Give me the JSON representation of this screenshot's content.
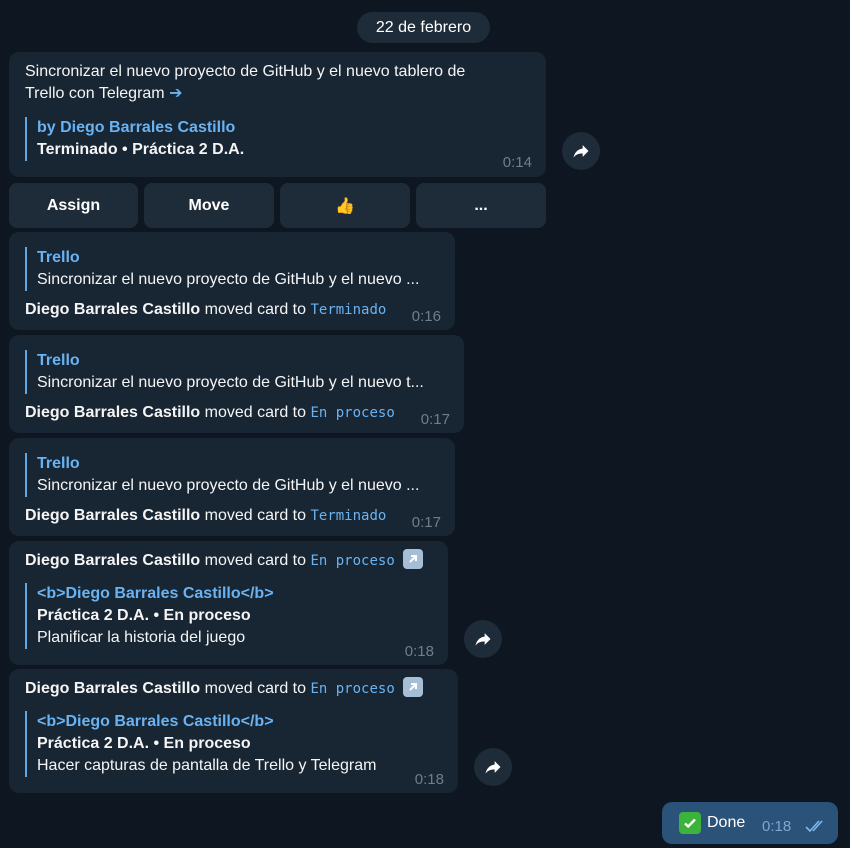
{
  "date_label": "22 de febrero",
  "msg1": {
    "text_line1": "Sincronizar el nuevo proyecto de GitHub y el nuevo tablero de",
    "text_line2": "Trello con Telegram",
    "arrow": "➔",
    "quote_author": "by Diego Barrales Castillo",
    "quote_status": "Terminado • Práctica 2 D.A.",
    "time": "0:14"
  },
  "keyboard": {
    "assign": "Assign",
    "move": "Move",
    "thumbs": "👍",
    "more": "..."
  },
  "msg2": {
    "quote_title": "Trello",
    "quote_text": "Sincronizar el nuevo proyecto de GitHub y el nuevo ...",
    "author": "Diego Barrales Castillo",
    "action": "moved card to",
    "list": "Terminado",
    "time": "0:16"
  },
  "msg3": {
    "quote_title": "Trello",
    "quote_text": "Sincronizar el nuevo proyecto de GitHub y el nuevo t...",
    "author": "Diego Barrales Castillo",
    "action": "moved card to",
    "list": "En proceso",
    "time": "0:17"
  },
  "msg4": {
    "quote_title": "Trello",
    "quote_text": "Sincronizar el nuevo proyecto de GitHub y el nuevo ...",
    "author": "Diego Barrales Castillo",
    "action": "moved card to",
    "list": "Terminado",
    "time": "0:17"
  },
  "msg5": {
    "author": "Diego Barrales Castillo",
    "action": "moved card to",
    "list": "En proceso",
    "quote_title": "<b>Diego Barrales Castillo</b>",
    "quote_status": "Práctica 2 D.A. • En proceso",
    "quote_text": "Planificar la historia del juego",
    "time": "0:18"
  },
  "msg6": {
    "author": "Diego Barrales Castillo",
    "action": "moved card to",
    "list": "En proceso",
    "quote_title": "<b>Diego Barrales Castillo</b>",
    "quote_status": "Práctica 2 D.A. • En proceso",
    "quote_text": "Hacer capturas de pantalla de Trello y Telegram",
    "time": "0:18"
  },
  "outgoing": {
    "text": "Done",
    "time": "0:18"
  },
  "colors": {
    "background": "#0e1621",
    "bubble": "#182533",
    "outgoing_bubble": "#2b5278",
    "accent": "#6ab3f3"
  }
}
